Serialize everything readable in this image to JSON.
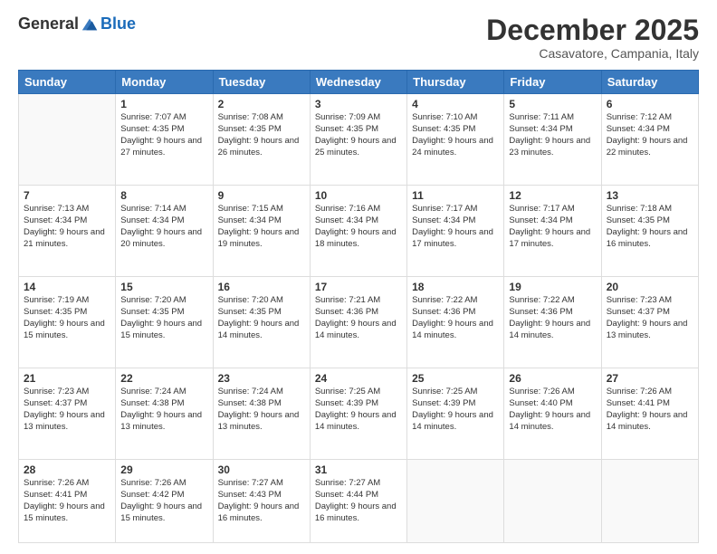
{
  "logo": {
    "general": "General",
    "blue": "Blue"
  },
  "header": {
    "month_title": "December 2025",
    "subtitle": "Casavatore, Campania, Italy"
  },
  "days_of_week": [
    "Sunday",
    "Monday",
    "Tuesday",
    "Wednesday",
    "Thursday",
    "Friday",
    "Saturday"
  ],
  "weeks": [
    [
      {
        "day": "",
        "sunrise": "",
        "sunset": "",
        "daylight": ""
      },
      {
        "day": "1",
        "sunrise": "Sunrise: 7:07 AM",
        "sunset": "Sunset: 4:35 PM",
        "daylight": "Daylight: 9 hours and 27 minutes."
      },
      {
        "day": "2",
        "sunrise": "Sunrise: 7:08 AM",
        "sunset": "Sunset: 4:35 PM",
        "daylight": "Daylight: 9 hours and 26 minutes."
      },
      {
        "day": "3",
        "sunrise": "Sunrise: 7:09 AM",
        "sunset": "Sunset: 4:35 PM",
        "daylight": "Daylight: 9 hours and 25 minutes."
      },
      {
        "day": "4",
        "sunrise": "Sunrise: 7:10 AM",
        "sunset": "Sunset: 4:35 PM",
        "daylight": "Daylight: 9 hours and 24 minutes."
      },
      {
        "day": "5",
        "sunrise": "Sunrise: 7:11 AM",
        "sunset": "Sunset: 4:34 PM",
        "daylight": "Daylight: 9 hours and 23 minutes."
      },
      {
        "day": "6",
        "sunrise": "Sunrise: 7:12 AM",
        "sunset": "Sunset: 4:34 PM",
        "daylight": "Daylight: 9 hours and 22 minutes."
      }
    ],
    [
      {
        "day": "7",
        "sunrise": "Sunrise: 7:13 AM",
        "sunset": "Sunset: 4:34 PM",
        "daylight": "Daylight: 9 hours and 21 minutes."
      },
      {
        "day": "8",
        "sunrise": "Sunrise: 7:14 AM",
        "sunset": "Sunset: 4:34 PM",
        "daylight": "Daylight: 9 hours and 20 minutes."
      },
      {
        "day": "9",
        "sunrise": "Sunrise: 7:15 AM",
        "sunset": "Sunset: 4:34 PM",
        "daylight": "Daylight: 9 hours and 19 minutes."
      },
      {
        "day": "10",
        "sunrise": "Sunrise: 7:16 AM",
        "sunset": "Sunset: 4:34 PM",
        "daylight": "Daylight: 9 hours and 18 minutes."
      },
      {
        "day": "11",
        "sunrise": "Sunrise: 7:17 AM",
        "sunset": "Sunset: 4:34 PM",
        "daylight": "Daylight: 9 hours and 17 minutes."
      },
      {
        "day": "12",
        "sunrise": "Sunrise: 7:17 AM",
        "sunset": "Sunset: 4:34 PM",
        "daylight": "Daylight: 9 hours and 17 minutes."
      },
      {
        "day": "13",
        "sunrise": "Sunrise: 7:18 AM",
        "sunset": "Sunset: 4:35 PM",
        "daylight": "Daylight: 9 hours and 16 minutes."
      }
    ],
    [
      {
        "day": "14",
        "sunrise": "Sunrise: 7:19 AM",
        "sunset": "Sunset: 4:35 PM",
        "daylight": "Daylight: 9 hours and 15 minutes."
      },
      {
        "day": "15",
        "sunrise": "Sunrise: 7:20 AM",
        "sunset": "Sunset: 4:35 PM",
        "daylight": "Daylight: 9 hours and 15 minutes."
      },
      {
        "day": "16",
        "sunrise": "Sunrise: 7:20 AM",
        "sunset": "Sunset: 4:35 PM",
        "daylight": "Daylight: 9 hours and 14 minutes."
      },
      {
        "day": "17",
        "sunrise": "Sunrise: 7:21 AM",
        "sunset": "Sunset: 4:36 PM",
        "daylight": "Daylight: 9 hours and 14 minutes."
      },
      {
        "day": "18",
        "sunrise": "Sunrise: 7:22 AM",
        "sunset": "Sunset: 4:36 PM",
        "daylight": "Daylight: 9 hours and 14 minutes."
      },
      {
        "day": "19",
        "sunrise": "Sunrise: 7:22 AM",
        "sunset": "Sunset: 4:36 PM",
        "daylight": "Daylight: 9 hours and 14 minutes."
      },
      {
        "day": "20",
        "sunrise": "Sunrise: 7:23 AM",
        "sunset": "Sunset: 4:37 PM",
        "daylight": "Daylight: 9 hours and 13 minutes."
      }
    ],
    [
      {
        "day": "21",
        "sunrise": "Sunrise: 7:23 AM",
        "sunset": "Sunset: 4:37 PM",
        "daylight": "Daylight: 9 hours and 13 minutes."
      },
      {
        "day": "22",
        "sunrise": "Sunrise: 7:24 AM",
        "sunset": "Sunset: 4:38 PM",
        "daylight": "Daylight: 9 hours and 13 minutes."
      },
      {
        "day": "23",
        "sunrise": "Sunrise: 7:24 AM",
        "sunset": "Sunset: 4:38 PM",
        "daylight": "Daylight: 9 hours and 13 minutes."
      },
      {
        "day": "24",
        "sunrise": "Sunrise: 7:25 AM",
        "sunset": "Sunset: 4:39 PM",
        "daylight": "Daylight: 9 hours and 14 minutes."
      },
      {
        "day": "25",
        "sunrise": "Sunrise: 7:25 AM",
        "sunset": "Sunset: 4:39 PM",
        "daylight": "Daylight: 9 hours and 14 minutes."
      },
      {
        "day": "26",
        "sunrise": "Sunrise: 7:26 AM",
        "sunset": "Sunset: 4:40 PM",
        "daylight": "Daylight: 9 hours and 14 minutes."
      },
      {
        "day": "27",
        "sunrise": "Sunrise: 7:26 AM",
        "sunset": "Sunset: 4:41 PM",
        "daylight": "Daylight: 9 hours and 14 minutes."
      }
    ],
    [
      {
        "day": "28",
        "sunrise": "Sunrise: 7:26 AM",
        "sunset": "Sunset: 4:41 PM",
        "daylight": "Daylight: 9 hours and 15 minutes."
      },
      {
        "day": "29",
        "sunrise": "Sunrise: 7:26 AM",
        "sunset": "Sunset: 4:42 PM",
        "daylight": "Daylight: 9 hours and 15 minutes."
      },
      {
        "day": "30",
        "sunrise": "Sunrise: 7:27 AM",
        "sunset": "Sunset: 4:43 PM",
        "daylight": "Daylight: 9 hours and 16 minutes."
      },
      {
        "day": "31",
        "sunrise": "Sunrise: 7:27 AM",
        "sunset": "Sunset: 4:44 PM",
        "daylight": "Daylight: 9 hours and 16 minutes."
      },
      {
        "day": "",
        "sunrise": "",
        "sunset": "",
        "daylight": ""
      },
      {
        "day": "",
        "sunrise": "",
        "sunset": "",
        "daylight": ""
      },
      {
        "day": "",
        "sunrise": "",
        "sunset": "",
        "daylight": ""
      }
    ]
  ]
}
